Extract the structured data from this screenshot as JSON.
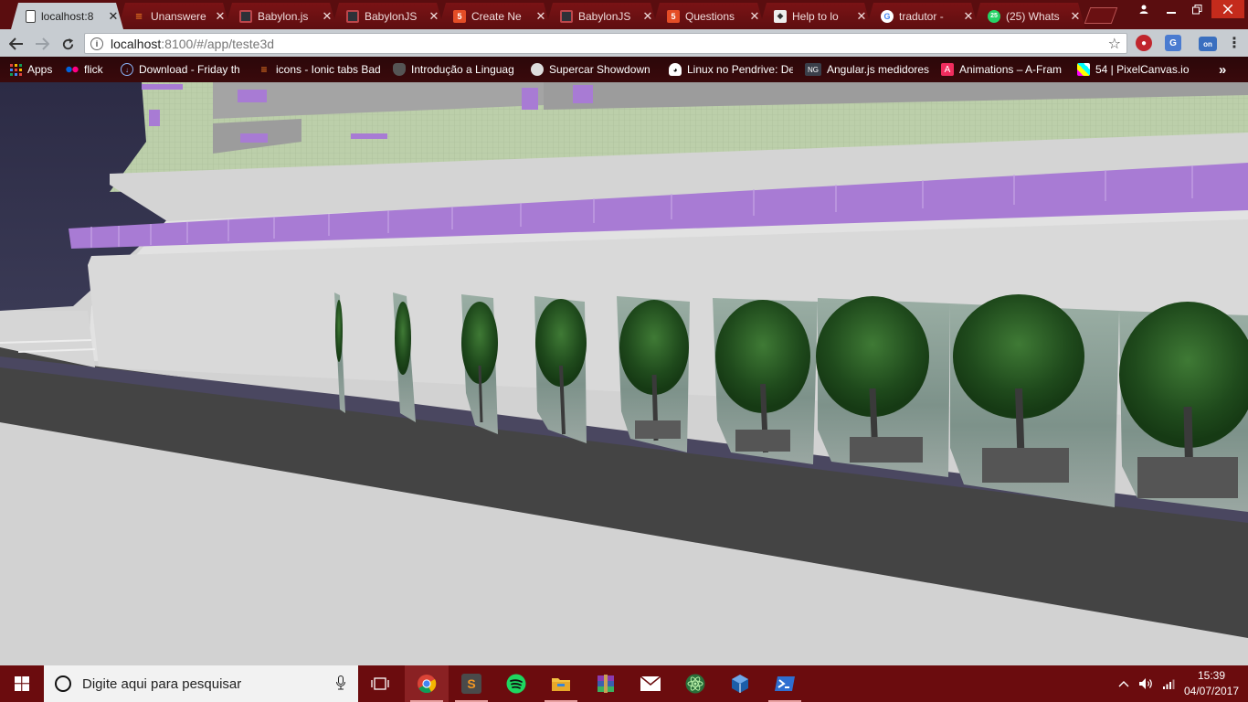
{
  "browser": {
    "tabs": [
      {
        "label": "localhost:8",
        "active": true,
        "favicon": "page-icon"
      },
      {
        "label": "Unanswere",
        "favicon": "stackoverflow-icon"
      },
      {
        "label": "Babylon.js",
        "favicon": "babylonjs-icon"
      },
      {
        "label": "BabylonJS",
        "favicon": "babylonjs-icon"
      },
      {
        "label": "Create Ne",
        "favicon": "html5-icon"
      },
      {
        "label": "BabylonJS",
        "favicon": "babylonjs-icon"
      },
      {
        "label": "Questions",
        "favicon": "html5-icon"
      },
      {
        "label": "Help to lo",
        "favicon": "codepen-icon"
      },
      {
        "label": "tradutor -",
        "favicon": "google-icon"
      },
      {
        "label": "(25) Whats",
        "favicon": "whatsapp-icon",
        "badge": "25"
      }
    ],
    "close_glyph": "✕",
    "url_host": "localhost",
    "url_path": ":8100/#/app/teste3d",
    "info_glyph": "i",
    "star_glyph": "☆",
    "bookmarks": [
      {
        "label": "Apps",
        "icon": "apps-grid-icon"
      },
      {
        "label": "flick",
        "icon": "flickr-icon"
      },
      {
        "label": "Download - Friday th",
        "icon": "download-icon"
      },
      {
        "label": "icons - Ionic tabs Bad",
        "icon": "stackoverflow-icon"
      },
      {
        "label": "Introdução a Linguag",
        "icon": "shield-icon"
      },
      {
        "label": "Supercar Showdown",
        "icon": "game-icon"
      },
      {
        "label": "Linux no Pendrive: De",
        "icon": "linux-icon"
      },
      {
        "label": "Angular.js medidores",
        "icon": "ng-icon"
      },
      {
        "label": "Animations – A-Fram",
        "icon": "aframe-icon"
      },
      {
        "label": "54 | PixelCanvas.io",
        "icon": "pixelcanvas-icon"
      }
    ],
    "more_bookmarks_glyph": "»",
    "ext_badge": "on"
  },
  "taskbar": {
    "search_placeholder": "Digite aqui para pesquisar",
    "time": "15:39",
    "date": "04/07/2017",
    "apps": [
      "task-view-icon",
      "chrome-icon",
      "sublime-text-icon",
      "spotify-icon",
      "file-explorer-icon",
      "winrar-icon",
      "mail-icon",
      "atom-icon",
      "virtualbox-icon",
      "powershell-icon"
    ]
  },
  "colors": {
    "tabstrip": "#5a0d0f",
    "taskbar": "#6b0c0e",
    "facade_purple": "#a87bd4",
    "facade_green": "#b8cca6",
    "wall": "#d2d2d2",
    "road": "#444444"
  }
}
